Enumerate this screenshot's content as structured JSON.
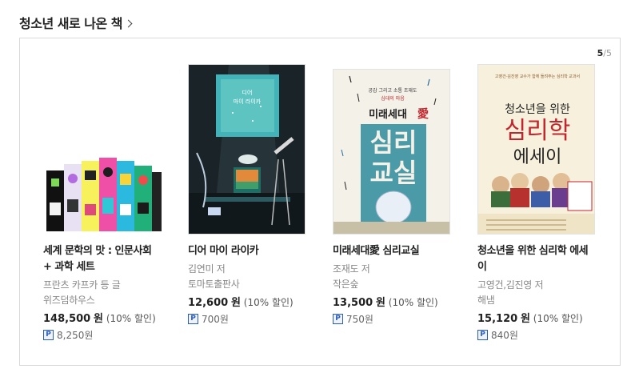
{
  "section": {
    "title": "청소년 새로 나온 책"
  },
  "pager": {
    "current": "5",
    "total": "/5"
  },
  "books": [
    {
      "title_line1": "세계 문학의 맛 : 인문사회",
      "title_line2": "+ 과학 세트",
      "author": "프란츠 카프카 등 글",
      "publisher": "위즈덤하우스",
      "price": "148,500",
      "price_unit": "원",
      "discount": "(10% 할인)",
      "point": "8,250원"
    },
    {
      "title_line1": "디어 마이 라이카",
      "title_line2": "",
      "author": "김연미 저",
      "publisher": "토마토출판사",
      "price": "12,600",
      "price_unit": "원",
      "discount": "(10% 할인)",
      "point": "700원",
      "cover_title": "디어 마이 라이카"
    },
    {
      "title_line1": "미래세대愛 심리교실",
      "title_line2": "",
      "author": "조재도 저",
      "publisher": "작은숲",
      "price": "13,500",
      "price_unit": "원",
      "discount": "(10% 할인)",
      "point": "750원",
      "cover_title_top": "미래세대",
      "cover_title_love": "愛",
      "cover_title_main1": "심리",
      "cover_title_main2": "교실"
    },
    {
      "title_line1": "청소년을 위한 심리학 에세",
      "title_line2": "이",
      "author": "고영건,김진영 저",
      "publisher": "해냄",
      "price": "15,120",
      "price_unit": "원",
      "discount": "(10% 할인)",
      "point": "840원",
      "cover_title_top": "청소년을 위한",
      "cover_title_main": "심리학",
      "cover_title_sub": "에세이"
    }
  ],
  "point_badge": "P",
  "colors": {
    "point_blue": "#2b5db8",
    "cover2_bg": "#1c2b33",
    "cover3_bg": "#f3f0e6",
    "cover3_accent": "#4a9aa7",
    "cover4_bg": "#f6efd9",
    "cover4_accent": "#c0262d"
  }
}
